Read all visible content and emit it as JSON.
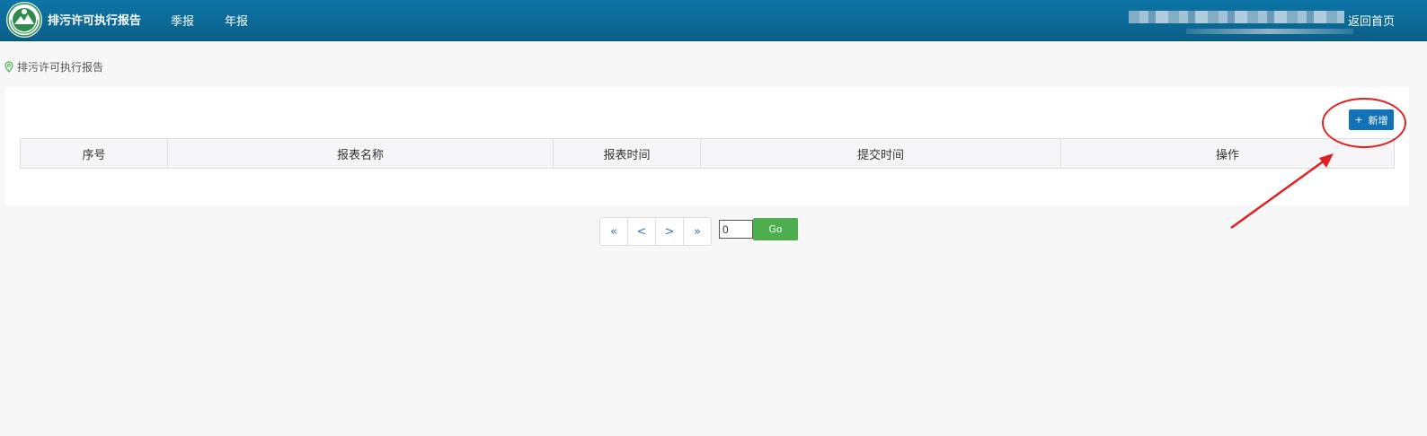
{
  "header": {
    "app_title": "排污许可执行报告",
    "nav": [
      {
        "label": "季报"
      },
      {
        "label": "年报"
      }
    ],
    "return_link": "返回首页",
    "logo_icon": "environment-protection-emblem-icon"
  },
  "breadcrumb": {
    "icon": "location-pin-icon",
    "text": "排污许可执行报告"
  },
  "toolbar": {
    "add_label": "新增",
    "add_icon": "plus-icon"
  },
  "table": {
    "columns": [
      "序号",
      "报表名称",
      "报表时间",
      "提交时间",
      "操作"
    ],
    "rows": []
  },
  "pagination": {
    "first": "«",
    "prev": "<",
    "next": ">",
    "last": "»",
    "page_input_value": "0",
    "go_label": "Go"
  },
  "annotation": {
    "ellipse_color": "#e02020",
    "arrow_color": "#e02020"
  },
  "colors": {
    "header_bg": "#0d75a7",
    "primary_button": "#1272b8",
    "go_button": "#4cae4c"
  }
}
